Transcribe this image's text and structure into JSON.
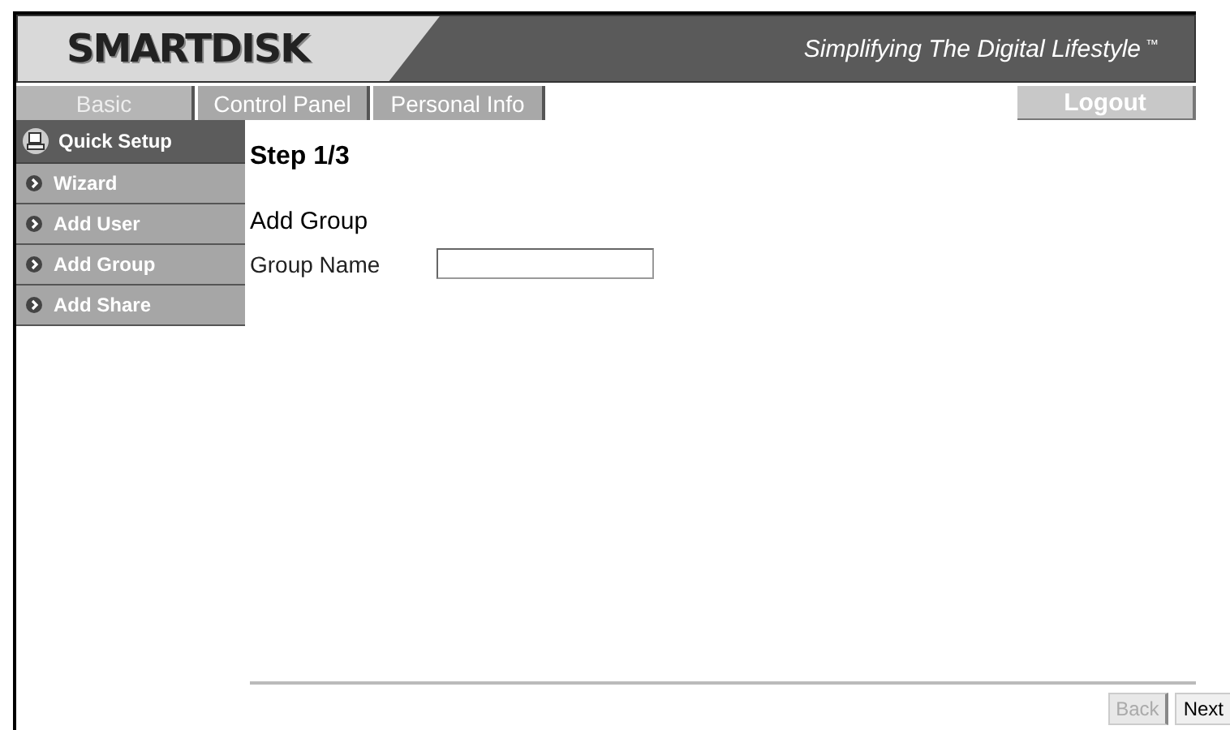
{
  "header": {
    "logo": "SMARTDISK",
    "tagline": "Simplifying The Digital Lifestyle",
    "trademark": "™"
  },
  "tabs": [
    {
      "label": "Basic",
      "selected": true
    },
    {
      "label": "Control Panel",
      "selected": false
    },
    {
      "label": "Personal Info",
      "selected": false
    }
  ],
  "logout": "Logout",
  "sidebar": {
    "title": "Quick Setup",
    "items": [
      {
        "label": "Wizard"
      },
      {
        "label": "Add User"
      },
      {
        "label": "Add Group"
      },
      {
        "label": "Add Share"
      }
    ]
  },
  "content": {
    "step": "Step 1/3",
    "section": "Add Group",
    "field": {
      "label": "Group Name"
    }
  },
  "buttons": [
    {
      "label": "Back",
      "disabled": true
    },
    {
      "label": "Next",
      "disabled": false
    }
  ]
}
